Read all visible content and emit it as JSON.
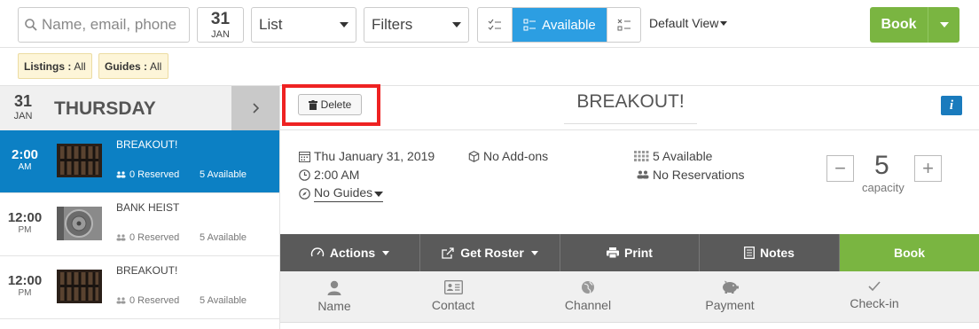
{
  "toolbar": {
    "search_placeholder": "Name, email, phone",
    "date_day": "31",
    "date_month": "JAN",
    "view_select": "List",
    "filters_select": "Filters",
    "available_label": "Available",
    "default_view": "Default View",
    "book_label": "Book"
  },
  "filters": {
    "listings_label": "Listings :",
    "listings_value": "All",
    "guides_label": "Guides :",
    "guides_value": "All"
  },
  "day": {
    "day": "31",
    "month": "JAN",
    "weekday": "THURSDAY"
  },
  "slots": [
    {
      "hour": "2:00",
      "ampm": "AM",
      "name": "BREAKOUT!",
      "reserved": "0 Reserved",
      "available": "5 Available"
    },
    {
      "hour": "12:00",
      "ampm": "PM",
      "name": "BANK HEIST",
      "reserved": "0 Reserved",
      "available": "5 Available"
    },
    {
      "hour": "12:00",
      "ampm": "PM",
      "name": "BREAKOUT!",
      "reserved": "0 Reserved",
      "available": "5 Available"
    }
  ],
  "detail": {
    "delete_label": "Delete",
    "title": "BREAKOUT!",
    "info_icon": "i",
    "date": "Thu January 31, 2019",
    "time": "2:00 AM",
    "guides": "No Guides",
    "addons": "No Add-ons",
    "available": "5 Available",
    "reservations": "No Reservations",
    "capacity_value": "5",
    "capacity_label": "capacity",
    "minus": "−",
    "plus": "+"
  },
  "actions": {
    "actions_label": "Actions",
    "roster_label": "Get Roster",
    "print_label": "Print",
    "notes_label": "Notes",
    "book_label": "Book"
  },
  "columns": [
    "Name",
    "Contact",
    "Channel",
    "Payment",
    "Check-in"
  ],
  "colors": {
    "primary_blue": "#2c9ee2",
    "selected_blue": "#0c80c4",
    "book_green": "#7ab541",
    "highlight_red": "#ee2222"
  }
}
